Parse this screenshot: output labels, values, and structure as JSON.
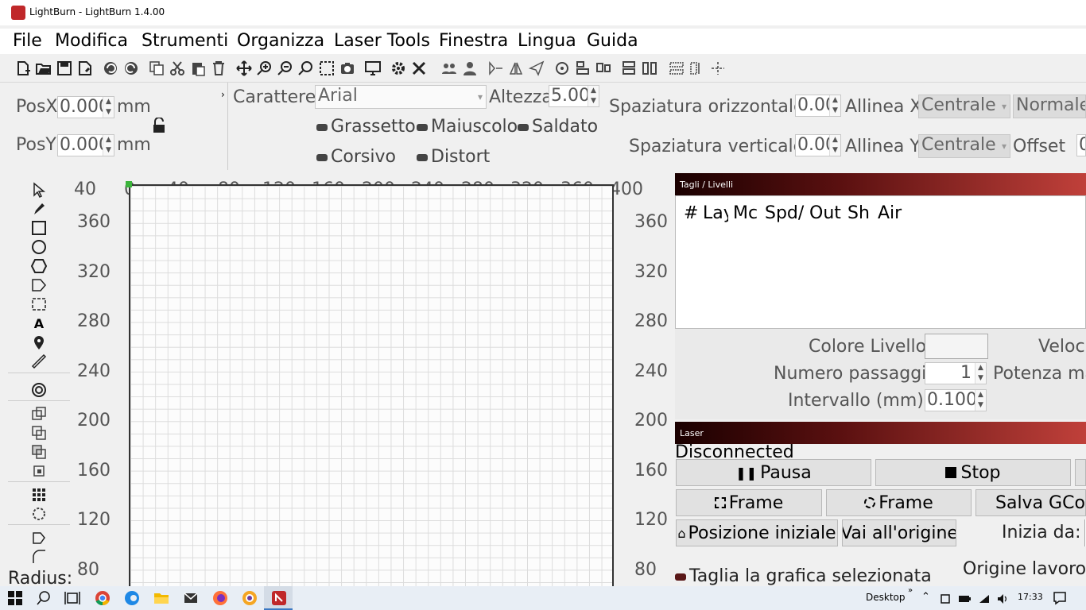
{
  "window": {
    "title": "LightBurn - LightBurn 1.4.00"
  },
  "menu": [
    "File",
    "Modifica",
    "Strumenti",
    "Organizza",
    "Laser Tools",
    "Finestra",
    "Lingua",
    "Guida"
  ],
  "toolbar_icons": [
    "new-file",
    "open-folder",
    "save",
    "save-as",
    "undo",
    "redo",
    "copy",
    "cut",
    "paste",
    "delete",
    "move",
    "zoom-in",
    "zoom-out",
    "zoom-fit",
    "zoom-selection",
    "camera",
    "monitor",
    "settings",
    "tools",
    "group",
    "user",
    "mirror",
    "flip",
    "send",
    "target",
    "align",
    "distribute",
    "dock",
    "ungroup",
    "grid",
    "array"
  ],
  "properties": {
    "posx_label": "PosX",
    "posx_value": "0.000",
    "posy_label": "PosY",
    "posy_value": "0.000",
    "unit": "mm",
    "font_label": "Carattere",
    "font_value": "Arial",
    "height_label": "Altezza",
    "height_value": "5.00",
    "bold": "Grassetto",
    "upper": "Maiuscolo",
    "welded": "Saldato",
    "italic": "Corsivo",
    "distort": "Distort",
    "hspace_label": "Spaziatura orizzontale",
    "hspace_value": "0.00",
    "vspace_label": "Spaziatura verticale",
    "vspace_value": "0.00",
    "alignx_label": "Allinea X",
    "alignx_value": "Centrale",
    "aligny_label": "Allinea Y",
    "aligny_value": "Centrale",
    "normal_value": "Normale",
    "offset_label": "Offset",
    "offset_value": "0"
  },
  "ruler": {
    "x": [
      "40",
      "0",
      "40",
      "80",
      "120",
      "160",
      "200",
      "240",
      "280",
      "320",
      "360",
      "400"
    ],
    "y": [
      "360",
      "320",
      "280",
      "240",
      "200",
      "160",
      "120",
      "80"
    ]
  },
  "left_panel": {
    "radius_label": "Radius:"
  },
  "cuts": {
    "title": "Tagli / Livelli",
    "columns": [
      "#",
      "Lay",
      "Mc",
      "Spd/",
      "Out",
      "Sh",
      "Air"
    ],
    "layer_color_label": "Colore Livello",
    "speed_label": "Veloci",
    "passes_label": "Numero passaggi",
    "passes_value": "1",
    "power_label": "Potenza ma",
    "interval_label": "Intervallo (mm)",
    "interval_value": "0.100"
  },
  "laser": {
    "title": "Laser",
    "status": "Disconnected",
    "pause": "Pausa",
    "stop": "Stop",
    "frame1": "Frame",
    "frame2": "Frame",
    "save_gcode": "Salva GCod",
    "home": "Posizione iniziale",
    "goto_origin": "Vai all'origine",
    "start_from": "Inizia da:",
    "cut_selected": "Taglia la grafica selezionata",
    "job_origin": "Origine lavoro"
  },
  "taskbar": {
    "desktop": "Desktop",
    "time": "17:33"
  },
  "colors": {
    "panel_head_start": "#1a0000",
    "panel_head_end": "#c0403a",
    "brand": "#c0282a"
  }
}
